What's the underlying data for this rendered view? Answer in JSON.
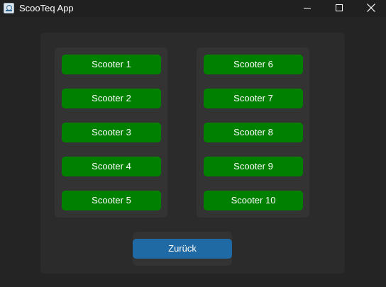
{
  "window": {
    "title": "ScooTeq App",
    "app_icon": "scooteq-app-icon",
    "controls": [
      "minimize-icon",
      "maximize-icon",
      "close-icon"
    ]
  },
  "colors": {
    "window_bg": "#242424",
    "titlebar_bg": "#202020",
    "frame_bg": "#2b2b2b",
    "column_bg": "#333333",
    "scooter_button": "#008000",
    "back_button": "#1f6aa5",
    "text": "#ffffff"
  },
  "scooters": {
    "left": [
      "Scooter 1",
      "Scooter 2",
      "Scooter 3",
      "Scooter 4",
      "Scooter 5"
    ],
    "right": [
      "Scooter 6",
      "Scooter 7",
      "Scooter 8",
      "Scooter 9",
      "Scooter 10"
    ]
  },
  "back_label": "Zurück"
}
